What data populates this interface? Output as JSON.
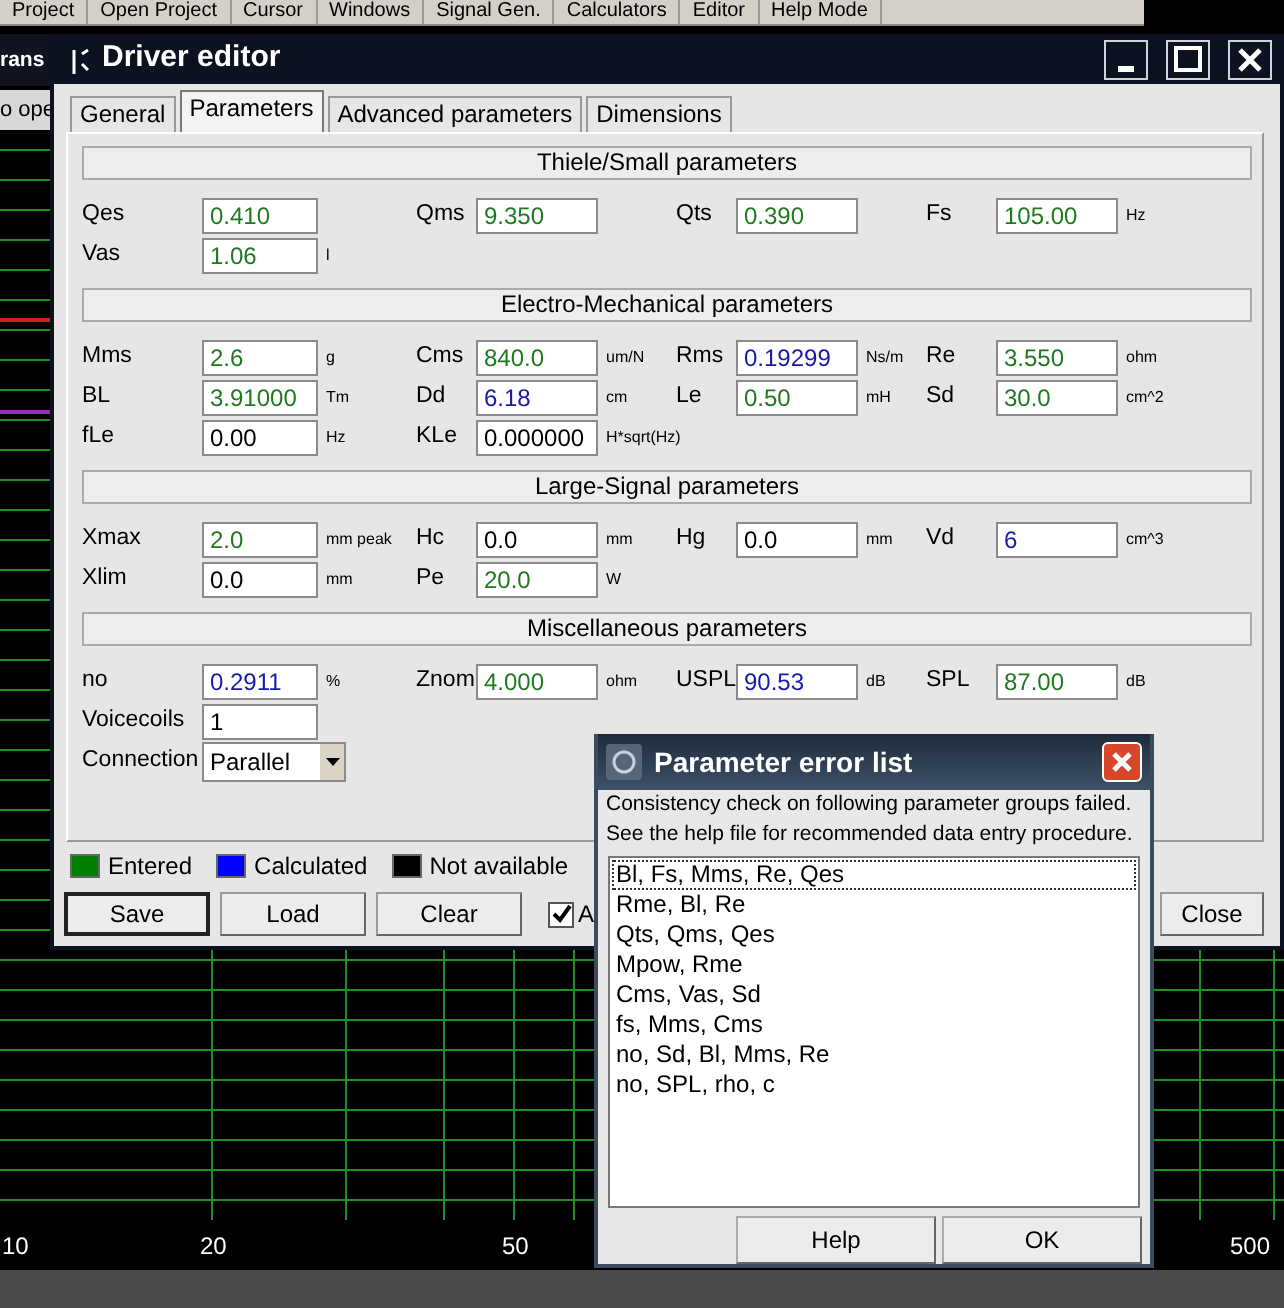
{
  "menu_bar": {
    "items": [
      "Project",
      "Open Project",
      "Cursor",
      "Windows",
      "Signal Gen.",
      "Calculators",
      "Editor",
      "Help Mode"
    ]
  },
  "background_window": {
    "title": "rans",
    "toolbar_text": "o ope"
  },
  "graph": {
    "x_labels": [
      "10",
      "20",
      "50",
      "500"
    ]
  },
  "driver_editor": {
    "title": "Driver editor",
    "tabs": [
      {
        "label": "General",
        "selected": false
      },
      {
        "label": "Parameters",
        "selected": true
      },
      {
        "label": "Advanced parameters",
        "selected": false
      },
      {
        "label": "Dimensions",
        "selected": false
      }
    ],
    "sections": [
      {
        "title": "Thiele/Small parameters",
        "rows": [
          [
            {
              "label": "Qes",
              "value": "0.410",
              "color": "#1f7a1f"
            },
            {
              "label": "Qms",
              "value": "9.350",
              "color": "#1f7a1f"
            },
            {
              "label": "Qts",
              "value": "0.390",
              "color": "#1f7a1f"
            },
            {
              "label": "Fs",
              "value": "105.00",
              "unit": "Hz",
              "color": "#1f7a1f"
            }
          ],
          [
            {
              "label": "Vas",
              "value": "1.06",
              "unit": "l",
              "color": "#1f7a1f"
            }
          ]
        ]
      },
      {
        "title": "Electro-Mechanical parameters",
        "rows": [
          [
            {
              "label": "Mms",
              "value": "2.6",
              "unit": "g",
              "color": "#1f7a1f"
            },
            {
              "label": "Cms",
              "value": "840.0",
              "unit": "um/N",
              "color": "#1f7a1f"
            },
            {
              "label": "Rms",
              "value": "0.19299",
              "unit": "Ns/m",
              "color": "#1a1aa8"
            },
            {
              "label": "Re",
              "value": "3.550",
              "unit": "ohm",
              "color": "#1f7a1f"
            }
          ],
          [
            {
              "label": "BL",
              "value": "3.91000",
              "unit": "Tm",
              "color": "#1f7a1f"
            },
            {
              "label": "Dd",
              "value": "6.18",
              "unit": "cm",
              "color": "#1a1aa8"
            },
            {
              "label": "Le",
              "value": "0.50",
              "unit": "mH",
              "color": "#1f7a1f"
            },
            {
              "label": "Sd",
              "value": "30.0",
              "unit": "cm^2",
              "color": "#1f7a1f"
            }
          ],
          [
            {
              "label": "fLe",
              "value": "0.00",
              "unit": "Hz",
              "color": "#000000"
            },
            {
              "label": "KLe",
              "value": "0.000000",
              "unit": "H*sqrt(Hz)",
              "color": "#000000"
            }
          ]
        ]
      },
      {
        "title": "Large-Signal parameters",
        "rows": [
          [
            {
              "label": "Xmax",
              "value": "2.0",
              "unit": "mm peak",
              "color": "#1f7a1f"
            },
            {
              "label": "Hc",
              "value": "0.0",
              "unit": "mm",
              "color": "#000000"
            },
            {
              "label": "Hg",
              "value": "0.0",
              "unit": "mm",
              "color": "#000000"
            },
            {
              "label": "Vd",
              "value": "6",
              "unit": "cm^3",
              "color": "#1a1aa8"
            }
          ],
          [
            {
              "label": "Xlim",
              "value": "0.0",
              "unit": "mm",
              "color": "#000000"
            },
            {
              "label": "Pe",
              "value": "20.0",
              "unit": "W",
              "color": "#1f7a1f"
            }
          ]
        ]
      },
      {
        "title": "Miscellaneous parameters",
        "rows": [
          [
            {
              "label": "no",
              "value": "0.2911",
              "unit": "%",
              "color": "#1a1aa8"
            },
            {
              "label": "Znom",
              "value": "4.000",
              "unit": "ohm",
              "color": "#1f7a1f"
            },
            {
              "label": "USPL",
              "value": "90.53",
              "unit": "dB",
              "color": "#1a1aa8"
            },
            {
              "label": "SPL",
              "value": "87.00",
              "unit": "dB",
              "color": "#1f7a1f"
            }
          ],
          [
            {
              "label": "Voicecoils",
              "value": "1",
              "color": "#000000"
            }
          ],
          [
            {
              "label": "Connection",
              "value": "Parallel",
              "kind": "dropdown"
            }
          ]
        ]
      }
    ],
    "legend": [
      {
        "label": "Entered",
        "color": "#008000"
      },
      {
        "label": "Calculated",
        "color": "#0000ff"
      },
      {
        "label": "Not available",
        "color": "#000000"
      }
    ],
    "buttons": [
      {
        "label": "Save",
        "focused": true
      },
      {
        "label": "Load",
        "focused": false
      },
      {
        "label": "Clear",
        "focused": false
      }
    ],
    "checkbox": {
      "label": "A",
      "checked": true
    },
    "close_button": "Close"
  },
  "error_dialog": {
    "title": "Parameter error list",
    "messages": [
      "Consistency check on following parameter groups failed.",
      "See the help file for recommended data entry procedure."
    ],
    "items": [
      {
        "text": "Bl, Fs, Mms, Re, Qes",
        "focused": true
      },
      {
        "text": "Rme, Bl, Re",
        "focused": false
      },
      {
        "text": "Qts, Qms, Qes",
        "focused": false
      },
      {
        "text": "Mpow, Rme",
        "focused": false
      },
      {
        "text": "Cms, Vas, Sd",
        "focused": false
      },
      {
        "text": "fs, Mms, Cms",
        "focused": false
      },
      {
        "text": "no, Sd, Bl, Mms, Re",
        "focused": false
      },
      {
        "text": "no, SPL, rho, c",
        "focused": false
      }
    ],
    "buttons": [
      "Help",
      "OK"
    ]
  }
}
